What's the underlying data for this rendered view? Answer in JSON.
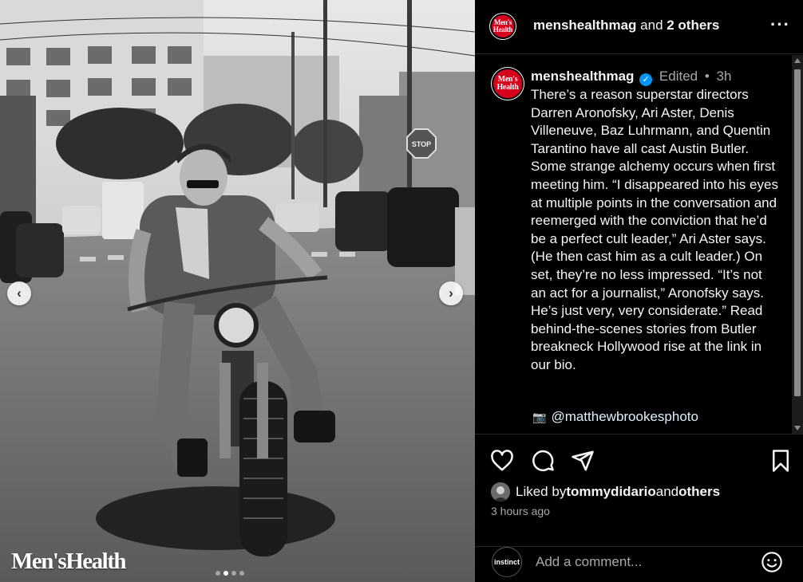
{
  "media": {
    "watermark": "Men'sHealth",
    "prev_icon": "chevron-left-icon",
    "next_icon": "chevron-right-icon",
    "slide_count": 4,
    "active_slide": 2
  },
  "header": {
    "logo_line1": "Men's",
    "logo_line2": "Health",
    "account": "menshealthmag",
    "joiner": " and ",
    "others": "2 others",
    "more_icon": "more-options-icon"
  },
  "caption": {
    "username": "menshealthmag",
    "edited": "Edited",
    "dot": "•",
    "time": "3h",
    "text": "There’s a reason superstar directors Darren Aronofsky, Ari Aster, Denis Villeneuve, Baz Luhrmann, and Quentin Tarantino have all cast Austin Butler. Some strange alchemy occurs when first meeting him. “I disappeared into his eyes at multiple points in the conversation and reemerged with the conviction that he’d be a perfect cult leader,” Ari Aster says. (He then cast him as a cult leader.) On set, they’re no less impressed. “It’s not an act for a journalist,” Aronofsky says. He’s just very, very considerate.” Read behind-the-scenes stories from Butler breakneck Hollywood rise at the link in our bio.",
    "camera_emoji": "📷",
    "credit_handle": "@matthewbrookesphoto"
  },
  "actions": {
    "liked_prefix": "Liked by ",
    "liked_user": "tommydidario",
    "liked_joiner": " and ",
    "liked_others": "others",
    "time_ago": "3 hours ago"
  },
  "comment": {
    "avatar_label": "instinct",
    "placeholder": "Add a comment..."
  },
  "colors": {
    "brand_red": "#d6001c",
    "verified_blue": "#0095f6",
    "link": "#e0f1ff"
  }
}
